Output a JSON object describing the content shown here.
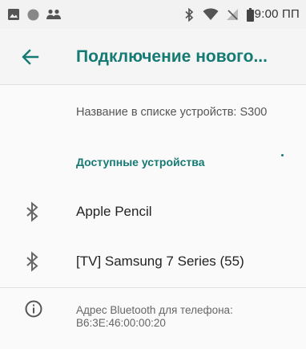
{
  "status_bar": {
    "time": "9:00 ПП",
    "left_icons": [
      "image-icon",
      "circle-icon",
      "people-icon"
    ],
    "right_icons": [
      "bluetooth-icon",
      "wifi-icon",
      "no-signal-icon",
      "battery-icon"
    ]
  },
  "app_bar": {
    "title": "Подключение нового...",
    "back_icon": "arrow-left-icon"
  },
  "device_name": {
    "text": "Название в списке устройств: S300"
  },
  "available_devices": {
    "header": "Доступные устройства",
    "items": [
      {
        "label": "Apple Pencil",
        "icon": "bluetooth-icon"
      },
      {
        "label": "[TV] Samsung 7 Series (55)",
        "icon": "bluetooth-icon"
      }
    ]
  },
  "info": {
    "icon": "info-icon",
    "line1": "Адрес Bluetooth для телефона:",
    "line2": "B6:3E:46:00:00:20"
  },
  "colors": {
    "accent": "#157a74",
    "icon_gray": "#666666",
    "status_icon": "#555555"
  }
}
